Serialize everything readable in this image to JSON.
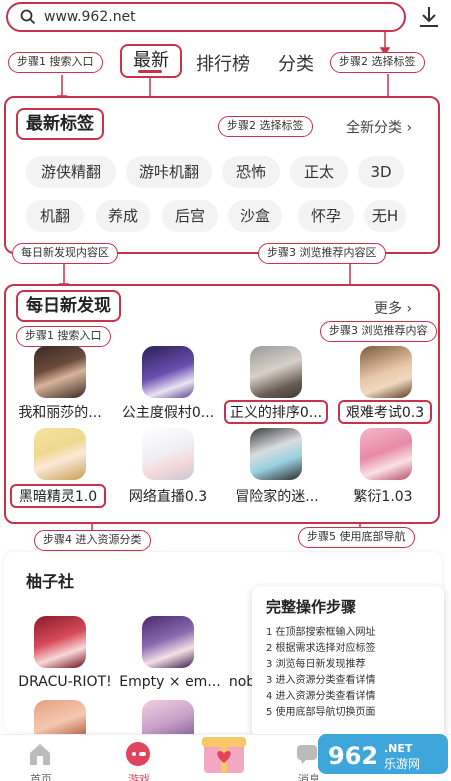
{
  "search": {
    "url": "www.962.net"
  },
  "steps": {
    "s1_search": "步骤1 搜索入口",
    "s2_tag": "步骤2 选择标签",
    "s2_tag_b": "步骤2 选择标签",
    "s3_browse": "步骤3 浏览推荐内容区",
    "daily_area": "每日新发现内容区",
    "s1_search_b": "步骤1 搜索入口",
    "s3_browse_b": "步骤3 浏览推荐内容",
    "s4_resource": "步骤4 进入资源分类",
    "s5_nav": "步骤5 使用底部导航"
  },
  "tabs": [
    {
      "label": "最新",
      "active": true
    },
    {
      "label": "排行榜"
    },
    {
      "label": "分类"
    }
  ],
  "latest_tags": {
    "title": "最新标签",
    "more": "全新分类",
    "tags": [
      "游侠精翻",
      "游咔机翻",
      "恐怖",
      "正太",
      "3D",
      "机翻",
      "养成",
      "后宫",
      "沙盒",
      "怀孕",
      "无H"
    ]
  },
  "daily": {
    "title": "每日新发现",
    "more": "更多",
    "games": [
      {
        "name": "我和丽莎的...",
        "icon": "woman-portrait-icon"
      },
      {
        "name": "公主度假村0...",
        "icon": "white-hair-character-icon"
      },
      {
        "name": "正义的排序0...",
        "icon": "woman-3d-icon"
      },
      {
        "name": "艰难考试0.3",
        "icon": "doll-face-icon"
      },
      {
        "name": "黑暗精灵1.0",
        "icon": "blonde-elf-icon"
      },
      {
        "name": "网络直播0.3",
        "icon": "white-hair-girl-icon"
      },
      {
        "name": "冒险家的迷...",
        "icon": "silver-hair-girl-icon"
      },
      {
        "name": "繁衍1.03",
        "icon": "pink-hair-girl-icon"
      }
    ]
  },
  "yuzu": {
    "title": "柚子社",
    "games": [
      {
        "name": "DRACU-RIOT!"
      },
      {
        "name": "Empty × em..."
      },
      {
        "name": "nob"
      }
    ]
  },
  "guide": {
    "title": "完整操作步骤",
    "items": [
      "1 在顶部搜索框输入网址",
      "2 根据需求选择对应标签",
      "3 浏览每日新发现推荐",
      "3 进入资源分类查看详情",
      "4 进入资源分类查看详情",
      "5 使用底部导航切换页面"
    ]
  },
  "nav": [
    {
      "label": "首页",
      "icon": "home-icon"
    },
    {
      "label": "游戏",
      "icon": "gamepad-icon"
    },
    {
      "label": "",
      "icon": "gift-icon"
    },
    {
      "label": "消息",
      "icon": "message-icon"
    }
  ],
  "watermark": "962乐游网",
  "colors": {
    "accent": "#c8324a",
    "tag_bg": "#f3f3f3"
  }
}
